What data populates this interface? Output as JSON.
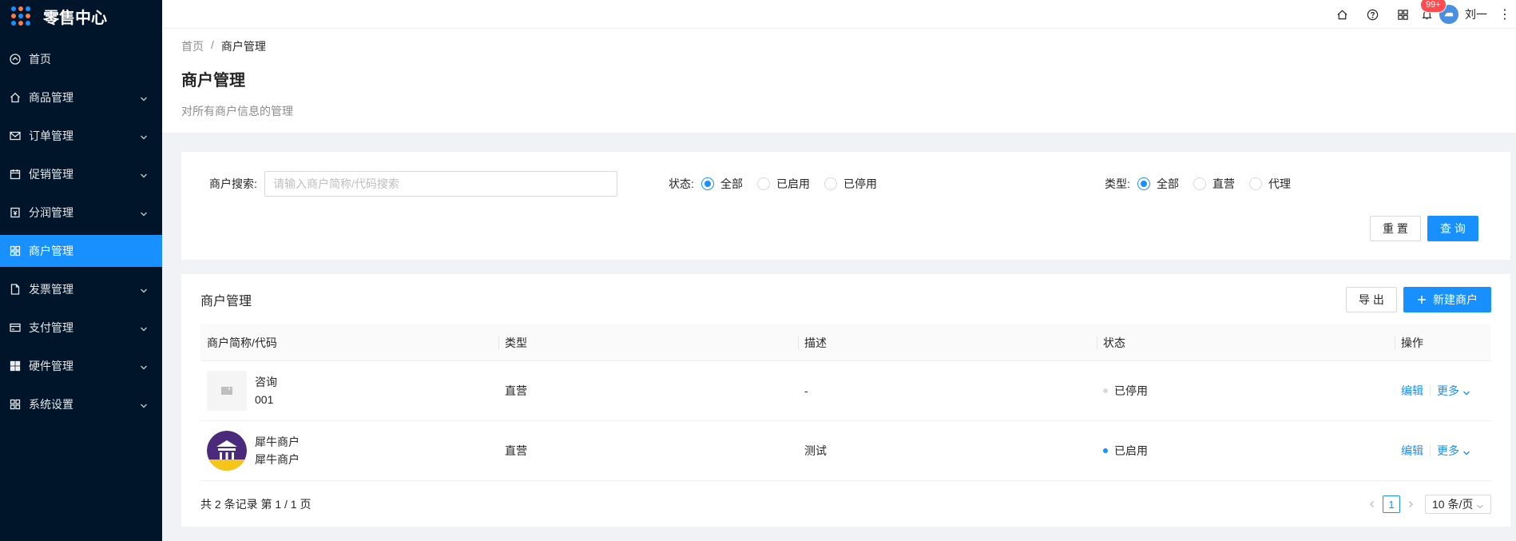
{
  "app": {
    "title": "零售中心"
  },
  "sidebar": {
    "items": [
      {
        "label": "首页",
        "icon": "dashboard-icon",
        "has_children": false,
        "active": false
      },
      {
        "label": "商品管理",
        "icon": "home-icon",
        "has_children": true,
        "active": false
      },
      {
        "label": "订单管理",
        "icon": "mail-icon",
        "has_children": true,
        "active": false
      },
      {
        "label": "促销管理",
        "icon": "calendar-icon",
        "has_children": true,
        "active": false
      },
      {
        "label": "分润管理",
        "icon": "account-book-icon",
        "has_children": true,
        "active": false
      },
      {
        "label": "商户管理",
        "icon": "appstore-icon",
        "has_children": false,
        "active": true
      },
      {
        "label": "发票管理",
        "icon": "file-icon",
        "has_children": true,
        "active": false
      },
      {
        "label": "支付管理",
        "icon": "credit-card-icon",
        "has_children": true,
        "active": false
      },
      {
        "label": "硬件管理",
        "icon": "appstore-filled-icon",
        "has_children": true,
        "active": false
      },
      {
        "label": "系统设置",
        "icon": "setting-grid-icon",
        "has_children": true,
        "active": false
      }
    ]
  },
  "topbar": {
    "badge": "99+",
    "user_name": "刘一",
    "more": "⋮"
  },
  "breadcrumb": {
    "home": "首页",
    "separator": "/",
    "current": "商户管理"
  },
  "page": {
    "title": "商户管理",
    "description": "对所有商户信息的管理"
  },
  "search": {
    "merchant_label": "商户搜索:",
    "merchant_placeholder": "请输入商户简称/代码搜索",
    "status_label": "状态:",
    "status_options": [
      "全部",
      "已启用",
      "已停用"
    ],
    "status_selected": "全部",
    "type_label": "类型:",
    "type_options": [
      "全部",
      "直营",
      "代理"
    ],
    "type_selected": "全部",
    "reset": "重 置",
    "query": "查 询"
  },
  "table_card": {
    "title": "商户管理",
    "export": "导 出",
    "new": "新建商户",
    "columns": [
      "商户简称/代码",
      "类型",
      "描述",
      "状态",
      "操作"
    ],
    "rows": [
      {
        "name": "咨询",
        "code": "001",
        "thumb": "image-placeholder-icon",
        "type": "直营",
        "desc": "-",
        "status": "已停用",
        "status_color": "#d9d9d9",
        "edit": "编辑",
        "more": "更多"
      },
      {
        "name": "犀牛商户",
        "code": "犀牛商户",
        "thumb": "merchant-logo-icon",
        "type": "直营",
        "desc": "测试",
        "status": "已启用",
        "status_color": "#1890ff",
        "edit": "编辑",
        "more": "更多"
      }
    ]
  },
  "pagination": {
    "total_text": "共 2 条记录 第 1 / 1 页",
    "current_page": "1",
    "page_size": "10 条/页"
  },
  "colors": {
    "sidebar_bg": "#001529",
    "primary": "#1890ff",
    "badge": "#ff4d4f"
  }
}
